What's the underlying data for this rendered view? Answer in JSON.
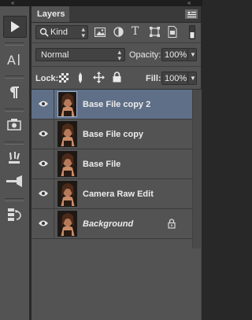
{
  "panel": {
    "tab_label": "Layers",
    "filter": {
      "kind_label": "Kind"
    },
    "blend_mode": "Normal",
    "opacity_label": "Opacity:",
    "opacity_value": "100%",
    "lock_label": "Lock:",
    "fill_label": "Fill:",
    "fill_value": "100%"
  },
  "layers": [
    {
      "name": "Base File copy 2",
      "selected": true,
      "italic": false
    },
    {
      "name": "Base File copy",
      "selected": false,
      "italic": false
    },
    {
      "name": "Base File",
      "selected": false,
      "italic": false
    },
    {
      "name": "Camera Raw Edit",
      "selected": false,
      "italic": false
    },
    {
      "name": "Background",
      "selected": false,
      "italic": true,
      "locked": true
    }
  ],
  "colors": {
    "panel_bg": "#535353",
    "selected_row": "#5f6f87",
    "field_bg": "#424242"
  }
}
